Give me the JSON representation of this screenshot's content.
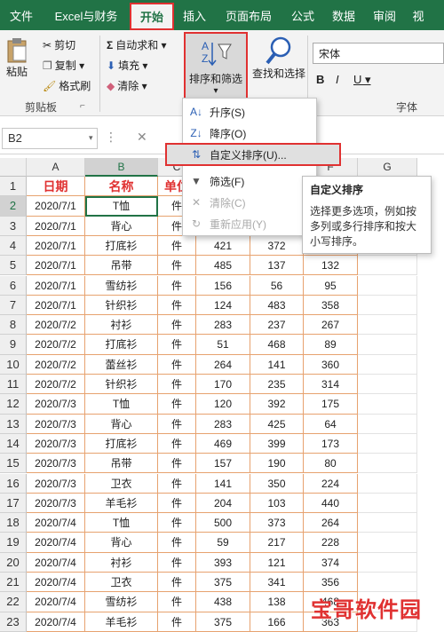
{
  "ribbon_tabs": [
    "文件",
    "Excel与财务",
    "开始",
    "插入",
    "页面布局",
    "公式",
    "数据",
    "审阅",
    "视"
  ],
  "clipboard": {
    "paste": "粘贴",
    "cut": "剪切",
    "copy": "复制 ▾",
    "format_painter": "格式刷",
    "group": "剪贴板",
    "launcher": "⌐"
  },
  "editing": {
    "autosum": "自动求和 ▾",
    "fill": "填充 ▾",
    "clear": "清除 ▾",
    "sort_filter": "排序和筛选",
    "find_select": "查找和选择",
    "sort_arrow": "▾"
  },
  "font": {
    "name": "宋体",
    "bold": "B",
    "italic": "I",
    "underline": "U ▾",
    "group": "字体"
  },
  "formula_bar": {
    "namebox": "B2",
    "cancel": "✕"
  },
  "menu": {
    "items": [
      {
        "icon": "A↓",
        "label": "升序(S)"
      },
      {
        "icon": "Z↓",
        "label": "降序(O)"
      },
      {
        "icon": "⇅",
        "label": "自定义排序(U)..."
      },
      {
        "icon": "▼",
        "label": "筛选(F)"
      },
      {
        "icon": "✕",
        "label": "清除(C)"
      },
      {
        "icon": "↻",
        "label": "重新应用(Y)"
      }
    ]
  },
  "tooltip": {
    "title": "自定义排序",
    "body": "选择更多选项，例如按多列或多行排序和按大小写排序。"
  },
  "columns": [
    "A",
    "B",
    "C",
    "D",
    "E",
    "F",
    "G"
  ],
  "header_row": [
    "日期",
    "名称",
    "单位"
  ],
  "rows": [
    [
      "2020/7/1",
      "T恤",
      "件",
      "",
      "",
      ""
    ],
    [
      "2020/7/1",
      "背心",
      "件",
      "",
      "",
      ""
    ],
    [
      "2020/7/1",
      "打底衫",
      "件",
      "421",
      "372",
      "181"
    ],
    [
      "2020/7/1",
      "吊带",
      "件",
      "485",
      "137",
      "132"
    ],
    [
      "2020/7/1",
      "雪纺衫",
      "件",
      "156",
      "56",
      "95"
    ],
    [
      "2020/7/1",
      "针织衫",
      "件",
      "124",
      "483",
      "358"
    ],
    [
      "2020/7/2",
      "衬衫",
      "件",
      "283",
      "237",
      "267"
    ],
    [
      "2020/7/2",
      "打底衫",
      "件",
      "51",
      "468",
      "89"
    ],
    [
      "2020/7/2",
      "蕾丝衫",
      "件",
      "264",
      "141",
      "360"
    ],
    [
      "2020/7/2",
      "针织衫",
      "件",
      "170",
      "235",
      "314"
    ],
    [
      "2020/7/3",
      "T恤",
      "件",
      "120",
      "392",
      "175"
    ],
    [
      "2020/7/3",
      "背心",
      "件",
      "283",
      "425",
      "64"
    ],
    [
      "2020/7/3",
      "打底衫",
      "件",
      "469",
      "399",
      "173"
    ],
    [
      "2020/7/3",
      "吊带",
      "件",
      "157",
      "190",
      "80"
    ],
    [
      "2020/7/3",
      "卫衣",
      "件",
      "141",
      "350",
      "224"
    ],
    [
      "2020/7/3",
      "羊毛衫",
      "件",
      "204",
      "103",
      "440"
    ],
    [
      "2020/7/4",
      "T恤",
      "件",
      "500",
      "373",
      "264"
    ],
    [
      "2020/7/4",
      "背心",
      "件",
      "59",
      "217",
      "228"
    ],
    [
      "2020/7/4",
      "衬衫",
      "件",
      "393",
      "121",
      "374"
    ],
    [
      "2020/7/4",
      "卫衣",
      "件",
      "375",
      "341",
      "356"
    ],
    [
      "2020/7/4",
      "雪纺衫",
      "件",
      "438",
      "138",
      "468"
    ],
    [
      "2020/7/4",
      "羊毛衫",
      "件",
      "375",
      "166",
      "363"
    ]
  ],
  "watermark": "宝哥软件园",
  "colors": {
    "accent": "#217346",
    "highlight": "#e03131",
    "cell_border": "#e7a26f"
  }
}
